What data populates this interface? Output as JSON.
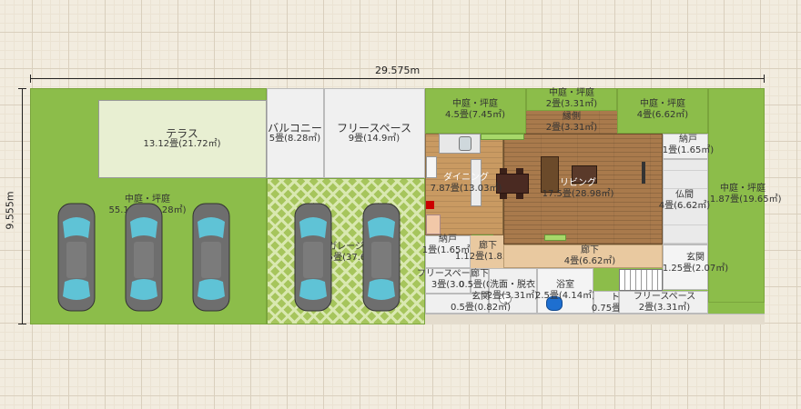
{
  "dimensions": {
    "width_label": "29.575m",
    "height_label": "9.555m"
  },
  "rooms": {
    "niwa_main": {
      "name": "中庭・坪庭",
      "area": "55.12畳(91.28㎡)"
    },
    "terrace": {
      "name": "テラス",
      "area": "13.12畳(21.72㎡)"
    },
    "balcony": {
      "name": "バルコニー",
      "area": "5畳(8.28㎡)"
    },
    "free_space_top": {
      "name": "フリースペース",
      "area": "9畳(14.9㎡)"
    },
    "garage": {
      "name": "ガレージ",
      "area": "22.75畳(37.67㎡)"
    },
    "niwa_a": {
      "name": "中庭・坪庭",
      "area": "4.5畳(7.45㎡)"
    },
    "niwa_b": {
      "name": "中庭・坪庭",
      "area": "2畳(3.31㎡)"
    },
    "engawa": {
      "name": "縁側",
      "area": "2畳(3.31㎡)"
    },
    "niwa_c": {
      "name": "中庭・坪庭",
      "area": "4畳(6.62㎡)"
    },
    "niwa_right": {
      "name": "中庭・坪庭",
      "area": "11.87畳(19.65㎡)"
    },
    "dining": {
      "name": "ダイニング",
      "area": "7.87畳(13.03㎡)"
    },
    "living": {
      "name": "リビング",
      "area": "17.5畳(28.98㎡)"
    },
    "nando_top": {
      "name": "納戸",
      "area": "1畳(1.65㎡)"
    },
    "butsuma": {
      "name": "仏間",
      "area": "4畳(6.62㎡)"
    },
    "nando_left": {
      "name": "納戸",
      "area": "1畳(1.65㎡)"
    },
    "rouka_small": {
      "name": "廊下",
      "area": "1.12畳(1.85㎡)"
    },
    "rouka": {
      "name": "廊下",
      "area": "4畳(6.62㎡)"
    },
    "genkan": {
      "name": "玄関",
      "area": "1.25畳(2.07㎡)"
    },
    "free_space_left": {
      "name": "フリースペース",
      "area": "3畳(3.0"
    },
    "senmen_datsui": {
      "name": "洗面・脱衣",
      "area": "2畳(3.31㎡)"
    },
    "yokushitsu": {
      "name": "浴室",
      "area": "2.5畳(4.14㎡)"
    },
    "toilet": {
      "name": "トイレ",
      "area": "0.75畳(1.24㎡)"
    },
    "free_space_right": {
      "name": "フリースペース",
      "area": "2畳(3.31㎡)"
    },
    "genkan_small": {
      "name": "玄関",
      "area": "0.5畳(0.82㎡)"
    },
    "rouka_tiny": {
      "name": "廊下",
      "area": "0.5畳(0.8"
    }
  },
  "colors": {
    "grass": "#8cbd4a",
    "floor": "#c99a62",
    "garage": "#a6c55c",
    "tatami": "#eaeaea"
  }
}
